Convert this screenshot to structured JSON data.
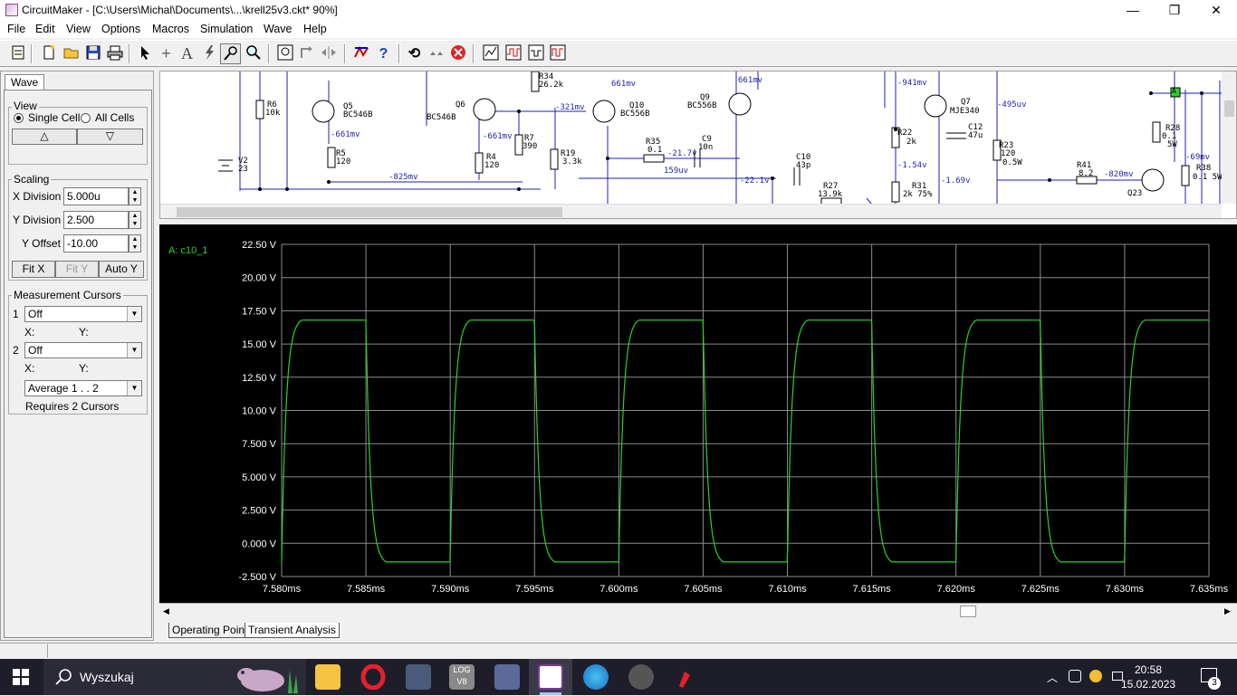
{
  "window": {
    "title": "CircuitMaker - [C:\\Users\\Michal\\Documents\\...\\krell25v3.ckt* 90%]",
    "minimize": "—",
    "maximize": "❐",
    "close": "✕"
  },
  "menu": [
    "File",
    "Edit",
    "View",
    "Options",
    "Macros",
    "Simulation",
    "Wave",
    "Help"
  ],
  "toolbar_icons": [
    "parts-icon",
    "new-icon",
    "open-icon",
    "save-icon",
    "print-icon",
    "arrow-tool-icon",
    "wire-tool-icon",
    "text-tool-icon",
    "probe-tool-icon",
    "zoom-tool-icon",
    "search-tool-icon",
    "zoom-fit-icon",
    "rotate-icon",
    "mirror-icon",
    "digital-sim-icon",
    "help-icon",
    "reset-icon",
    "step-icon",
    "stop-icon",
    "analysis-icon",
    "wave-icon",
    "trace-icon",
    "scope-icon"
  ],
  "panel": {
    "tab": "Wave",
    "view_group": "View",
    "single_cell": "Single Cell",
    "all_cells": "All Cells",
    "up_arrow": "△",
    "down_arrow": "▽",
    "scaling_group": "Scaling",
    "x_division_label": "X Division",
    "x_division_value": "5.000u",
    "y_division_label": "Y Division",
    "y_division_value": "2.500",
    "y_offset_label": "Y Offset",
    "y_offset_value": "-10.00",
    "fit_x": "Fit X",
    "fit_y": "Fit Y",
    "auto_y": "Auto Y",
    "cursors_group": "Measurement Cursors",
    "cursor1_num": "1",
    "cursor1_value": "Off",
    "cursor2_num": "2",
    "cursor2_value": "Off",
    "x_label": "X:",
    "y_label": "Y:",
    "average_value": "Average  1 . . 2",
    "requires": "Requires 2 Cursors"
  },
  "schematic": {
    "parts": [
      {
        "ref": "R6",
        "val": "10k"
      },
      {
        "ref": "Q5",
        "val": "BC546B"
      },
      {
        "ref": "R5",
        "val": "120"
      },
      {
        "ref": "V2",
        "val": "23"
      },
      {
        "ref": "Q6",
        "val": "BC546B"
      },
      {
        "ref": "R4",
        "val": "120"
      },
      {
        "ref": "R7",
        "val": "390"
      },
      {
        "ref": "R34",
        "val": "26.2k"
      },
      {
        "ref": "R19",
        "val": "3.3k"
      },
      {
        "ref": "Q10",
        "val": "BC556B"
      },
      {
        "ref": "R35",
        "val": "0.1"
      },
      {
        "ref": "C9",
        "val": "10n"
      },
      {
        "ref": "Q9",
        "val": "BC556B"
      },
      {
        "ref": "C10",
        "val": "43p"
      },
      {
        "ref": "R27",
        "val": "13.9k"
      },
      {
        "ref": "R22",
        "val": "2k"
      },
      {
        "ref": "R31",
        "val": "2k 75%"
      },
      {
        "ref": "Q7",
        "val": "MJE340"
      },
      {
        "ref": "C12",
        "val": "47u"
      },
      {
        "ref": "R23",
        "val": "120"
      },
      {
        "ref": "R41",
        "val": "8.2"
      },
      {
        "ref": "R28",
        "val": "0.1"
      },
      {
        "ref": "Q23",
        "val": ""
      },
      {
        "ref": "R38",
        "val": "0.1 5W"
      }
    ],
    "nets": [
      "-661mv",
      "-661mv",
      "-825mv",
      "-321mv",
      "661mv",
      "661mv",
      "-21.7v",
      "159uv",
      "-22.1v",
      "-941mv",
      "-1.54v",
      "-1.69v",
      "-495uv",
      "-820mv",
      "-69mv"
    ],
    "extra_labels": {
      "r23_power": "0.5W",
      "r28_power": "5W",
      "probe": "A"
    }
  },
  "scope": {
    "trace_name": "A: c10_1",
    "trace_color": "#2bd22b"
  },
  "chart_data": {
    "type": "line",
    "title": "",
    "xlabel": "",
    "ylabel": "",
    "x_ticks": [
      "7.580ms",
      "7.585ms",
      "7.590ms",
      "7.595ms",
      "7.600ms",
      "7.605ms",
      "7.610ms",
      "7.615ms",
      "7.620ms",
      "7.625ms",
      "7.630ms",
      "7.635ms"
    ],
    "y_ticks": [
      "22.50 V",
      "20.00 V",
      "17.50 V",
      "15.00 V",
      "12.50 V",
      "10.00 V",
      "7.500 V",
      "5.000 V",
      "2.500 V",
      "0.000 V",
      "-2.500 V"
    ],
    "xlim": [
      7.58,
      7.635
    ],
    "ylim": [
      -2.5,
      22.5
    ],
    "grid": true,
    "series": [
      {
        "name": "A: c10_1",
        "waveform": "square",
        "high": 16.8,
        "low": -1.4,
        "period_ms": 0.01,
        "rise_start_ms": [
          7.58,
          7.59,
          7.6,
          7.61,
          7.62,
          7.63
        ],
        "fall_start_ms": [
          7.585,
          7.595,
          7.605,
          7.615,
          7.625
        ],
        "transition_ms": 0.0012
      }
    ]
  },
  "bottom_tabs": [
    "Operating Point",
    "Transient Analysis"
  ],
  "taskbar": {
    "search": "Wyszukaj",
    "time": "20:58",
    "date": "15.02.2023",
    "notifications": "3",
    "apps": [
      "file-explorer-icon",
      "opera-icon",
      "calculator-icon",
      "logicv8-icon",
      "network-app-icon",
      "circuitmaker-icon",
      "edge-icon",
      "media-icon",
      "brush-app-icon"
    ]
  }
}
